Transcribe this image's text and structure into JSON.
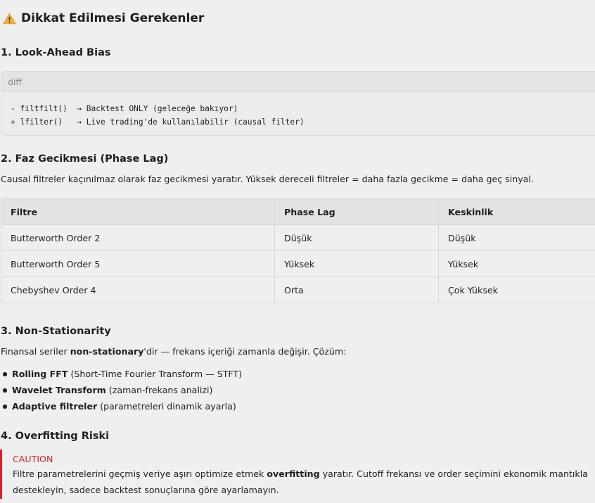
{
  "heading": "Dikkat Edilmesi Gerekenler",
  "section1": {
    "title": "1. Look-Ahead Bias",
    "code_lang": "diff",
    "code_lines": [
      "- filtfilt()  → Backtest ONLY (geleceğe bakıyor)",
      "+ lfilter()   → Live trading'de kullanılabilir (causal filter)"
    ]
  },
  "section2": {
    "title": "2. Faz Gecikmesi (Phase Lag)",
    "text": "Causal filtreler kaçınılmaz olarak faz gecikmesi yaratır. Yüksek dereceli filtreler = daha fazla gecikme = daha geç sinyal.",
    "table": {
      "headers": [
        "Filtre",
        "Phase Lag",
        "Keskinlik"
      ],
      "rows": [
        [
          "Butterworth Order 2",
          "Düşük",
          "Düşük"
        ],
        [
          "Butterworth Order 5",
          "Yüksek",
          "Yüksek"
        ],
        [
          "Chebyshev Order 4",
          "Orta",
          "Çok Yüksek"
        ]
      ]
    }
  },
  "section3": {
    "title": "3. Non-Stationarity",
    "text_pre": "Finansal seriler ",
    "text_bold": "non-stationary",
    "text_post": "'dir — frekans içeriği zamanla değişir. Çözüm:",
    "bullets": [
      {
        "bold": "Rolling FFT",
        "rest": " (Short-Time Fourier Transform — STFT)"
      },
      {
        "bold": "Wavelet Transform",
        "rest": " (zaman-frekans analizi)"
      },
      {
        "bold": "Adaptive filtreler",
        "rest": " (parametreleri dinamik ayarla)"
      }
    ]
  },
  "section4": {
    "title": "4. Overfitting Riski",
    "caution_label": "CAUTION",
    "caution_pre": "Filtre parametrelerini geçmiş veriye aşırı optimize etmek ",
    "caution_bold": "overfitting",
    "caution_post": " yaratır. Cutoff frekansı ve order seçimini ekonomik mantıkla destekleyin, sadece backtest sonuçlarına göre ayarlamayın."
  },
  "colors": {
    "caution": "#d1242f",
    "warning_icon": "#f3b43a"
  },
  "icons": {
    "heading": "warning-icon"
  }
}
